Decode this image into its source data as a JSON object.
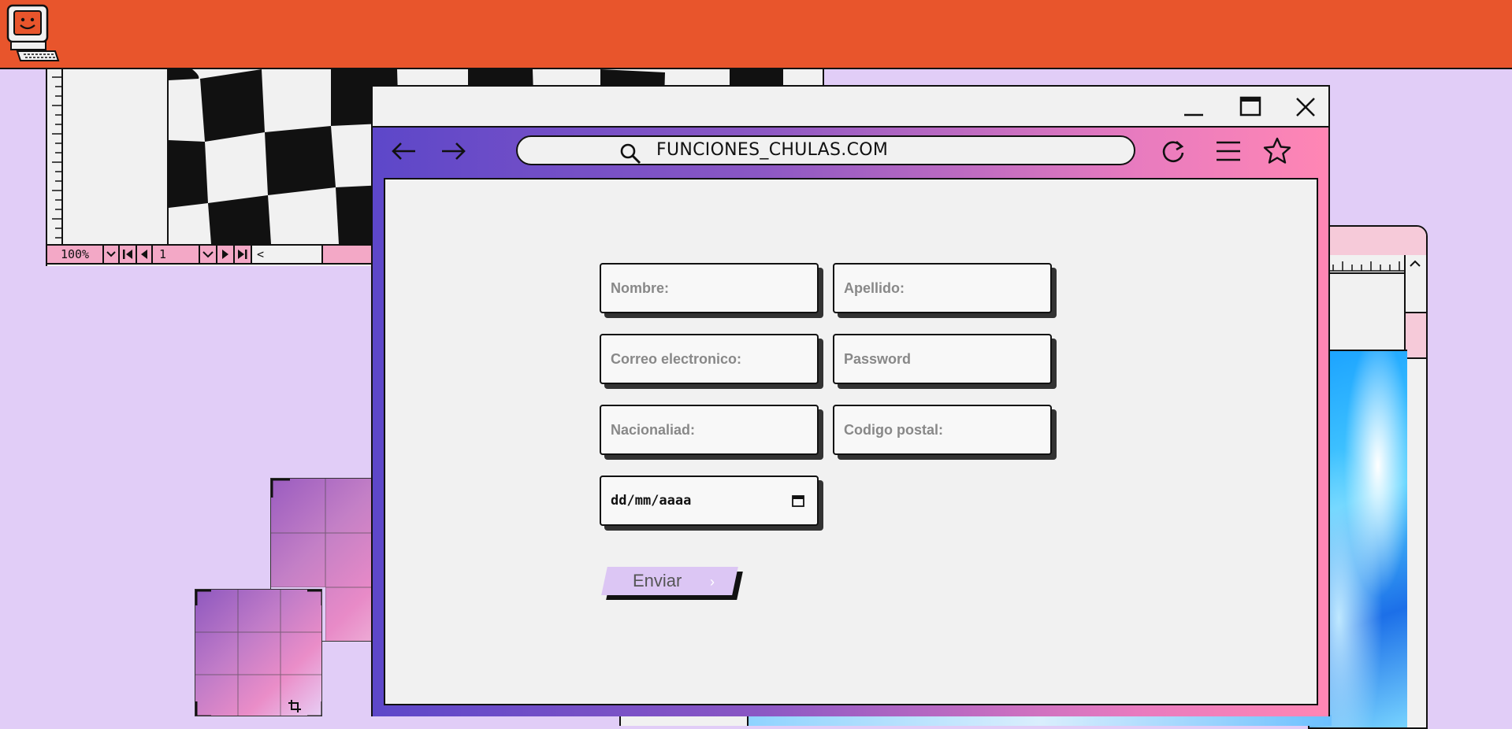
{
  "topbar": {
    "logo_icon": "retro-computer-smiley-icon",
    "color": "#e8552c"
  },
  "viewer": {
    "zoom": "100%",
    "page": "1",
    "scroll_left_glyph": "<"
  },
  "browser": {
    "url": "FUNCIONES_CHULAS.COM",
    "window_controls": [
      "minimize-icon",
      "maximize-icon",
      "close-icon"
    ],
    "nav_icons": [
      "arrow-left-icon",
      "arrow-right-icon",
      "search-icon",
      "refresh-icon",
      "menu-icon",
      "star-icon"
    ]
  },
  "form": {
    "nombre_placeholder": "Nombre:",
    "apellido_placeholder": "Apellido:",
    "correo_placeholder": "Correo electronico:",
    "password_placeholder": "Password",
    "nacionalidad_placeholder": "Nacionaliad:",
    "codigo_postal_placeholder": "Codigo postal:",
    "date_placeholder": "dd/mm/aaaa",
    "submit_label": "Enviar",
    "submit_chevron": "›"
  },
  "colors": {
    "background": "#e1cdf7",
    "accent_orange": "#e8552c",
    "gradient_start": "#5d47c9",
    "gradient_end": "#ff86b4",
    "button": "#dcc6f4"
  }
}
